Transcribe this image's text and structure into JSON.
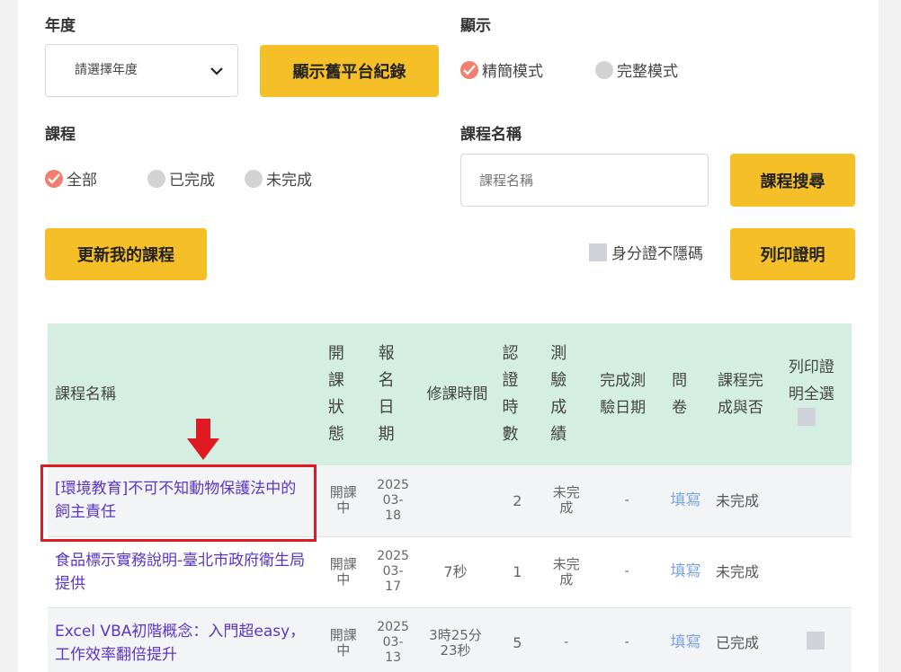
{
  "filters": {
    "year_label": "年度",
    "year_select": "請選擇年度",
    "legacy_button": "顯示舊平台紀錄",
    "display_label": "顯示",
    "display_options": [
      "精簡模式",
      "完整模式"
    ],
    "course_label": "課程",
    "course_options": [
      "全部",
      "已完成",
      "未完成"
    ],
    "course_name_label": "課程名稱",
    "course_name_placeholder": "課程名稱",
    "search_button": "課程搜尋",
    "refresh_button": "更新我的課程",
    "id_checkbox_label": "身分證不隱碼",
    "print_button": "列印證明"
  },
  "table": {
    "headers": {
      "name": "課程名稱",
      "status": "開課狀態",
      "enroll_date": "報名日期",
      "study_time": "修課時間",
      "cert_hours": "認證時數",
      "test_score": "測驗成績",
      "test_date": "完成測驗日期",
      "survey": "問卷",
      "completed": "課程完成與否",
      "print_select_all": "列印證明全選"
    },
    "rows": [
      {
        "name": "[環境教育]不可不知動物保護法中的飼主責任",
        "status": "開課中",
        "enroll_date": "2025 03- 18",
        "study_time": "",
        "cert_hours": "2",
        "test_score": "未完成",
        "test_date": "-",
        "survey": "填寫",
        "completed": "未完成"
      },
      {
        "name": "食品標示實務說明-臺北市政府衛生局提供",
        "status": "開課中",
        "enroll_date": "2025 03- 17",
        "study_time": "7秒",
        "cert_hours": "1",
        "test_score": "未完成",
        "test_date": "-",
        "survey": "填寫",
        "completed": "未完成"
      },
      {
        "name": "Excel VBA初階概念：入門超easy，工作效率翻倍提升",
        "status": "開課中",
        "enroll_date": "2025 03- 13",
        "study_time": "3時25分 23秒",
        "cert_hours": "5",
        "test_score": "-",
        "test_date": "-",
        "survey": "填寫",
        "completed": "已完成"
      }
    ]
  },
  "colors": {
    "accent": "#f5c027",
    "header_bg": "#d4efe2",
    "link": "#5a35c8",
    "highlight": "#e01a22",
    "radio_on": "#ef7f6f"
  }
}
